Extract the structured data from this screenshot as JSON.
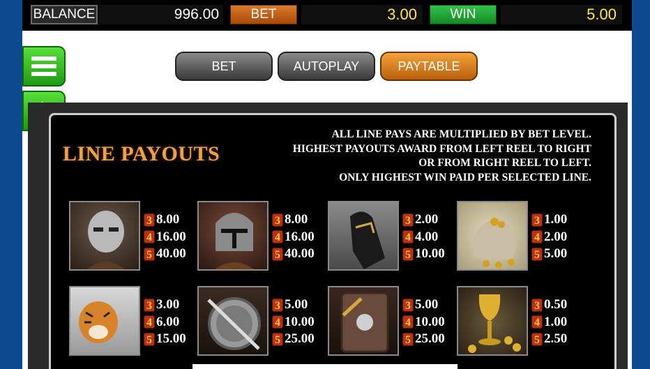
{
  "topbar": {
    "balance_label": "BALANCE",
    "balance_value": "996.00",
    "bet_label": "BET",
    "bet_value": "3.00",
    "win_label": "WIN",
    "win_value": "5.00"
  },
  "tabs": [
    {
      "label": "BET",
      "active": false
    },
    {
      "label": "AUTOPLAY",
      "active": false
    },
    {
      "label": "PAYTABLE",
      "active": true
    }
  ],
  "side_buttons": {
    "menu_icon": "hamburger-menu-icon",
    "back_icon": "arrow-left-icon"
  },
  "paytable": {
    "title": "LINE PAYOUTS",
    "rules": [
      "ALL LINE PAYS ARE MULTIPLIED BY BET LEVEL.",
      "HIGHEST PAYOUTS AWARD FROM LEFT REEL TO RIGHT",
      "OR FROM RIGHT REEL TO LEFT.",
      "ONLY HIGHEST WIN PAID PER SELECTED LINE."
    ],
    "symbols": [
      {
        "name": "masked-gladiator",
        "pays": [
          {
            "count": "3",
            "value": "8.00"
          },
          {
            "count": "4",
            "value": "16.00"
          },
          {
            "count": "5",
            "value": "40.00"
          }
        ]
      },
      {
        "name": "helmeted-gladiator",
        "pays": [
          {
            "count": "3",
            "value": "8.00"
          },
          {
            "count": "4",
            "value": "16.00"
          },
          {
            "count": "5",
            "value": "40.00"
          }
        ]
      },
      {
        "name": "horse",
        "pays": [
          {
            "count": "3",
            "value": "2.00"
          },
          {
            "count": "4",
            "value": "4.00"
          },
          {
            "count": "5",
            "value": "10.00"
          }
        ]
      },
      {
        "name": "coin-bag",
        "pays": [
          {
            "count": "3",
            "value": "1.00"
          },
          {
            "count": "4",
            "value": "2.00"
          },
          {
            "count": "5",
            "value": "5.00"
          }
        ]
      },
      {
        "name": "tiger",
        "pays": [
          {
            "count": "3",
            "value": "3.00"
          },
          {
            "count": "4",
            "value": "6.00"
          },
          {
            "count": "5",
            "value": "15.00"
          }
        ]
      },
      {
        "name": "round-shield-sword",
        "pays": [
          {
            "count": "3",
            "value": "5.00"
          },
          {
            "count": "4",
            "value": "10.00"
          },
          {
            "count": "5",
            "value": "25.00"
          }
        ]
      },
      {
        "name": "square-shield-mace",
        "pays": [
          {
            "count": "3",
            "value": "5.00"
          },
          {
            "count": "4",
            "value": "10.00"
          },
          {
            "count": "5",
            "value": "25.00"
          }
        ]
      },
      {
        "name": "golden-chalice",
        "pays": [
          {
            "count": "3",
            "value": "0.50"
          },
          {
            "count": "4",
            "value": "1.00"
          },
          {
            "count": "5",
            "value": "2.50"
          }
        ]
      }
    ]
  },
  "colors": {
    "accent_orange": "#d97a2a",
    "win_green": "#1e9a12",
    "value_yellow": "#ffe83a",
    "frame_blue": "#0d4a8f"
  }
}
